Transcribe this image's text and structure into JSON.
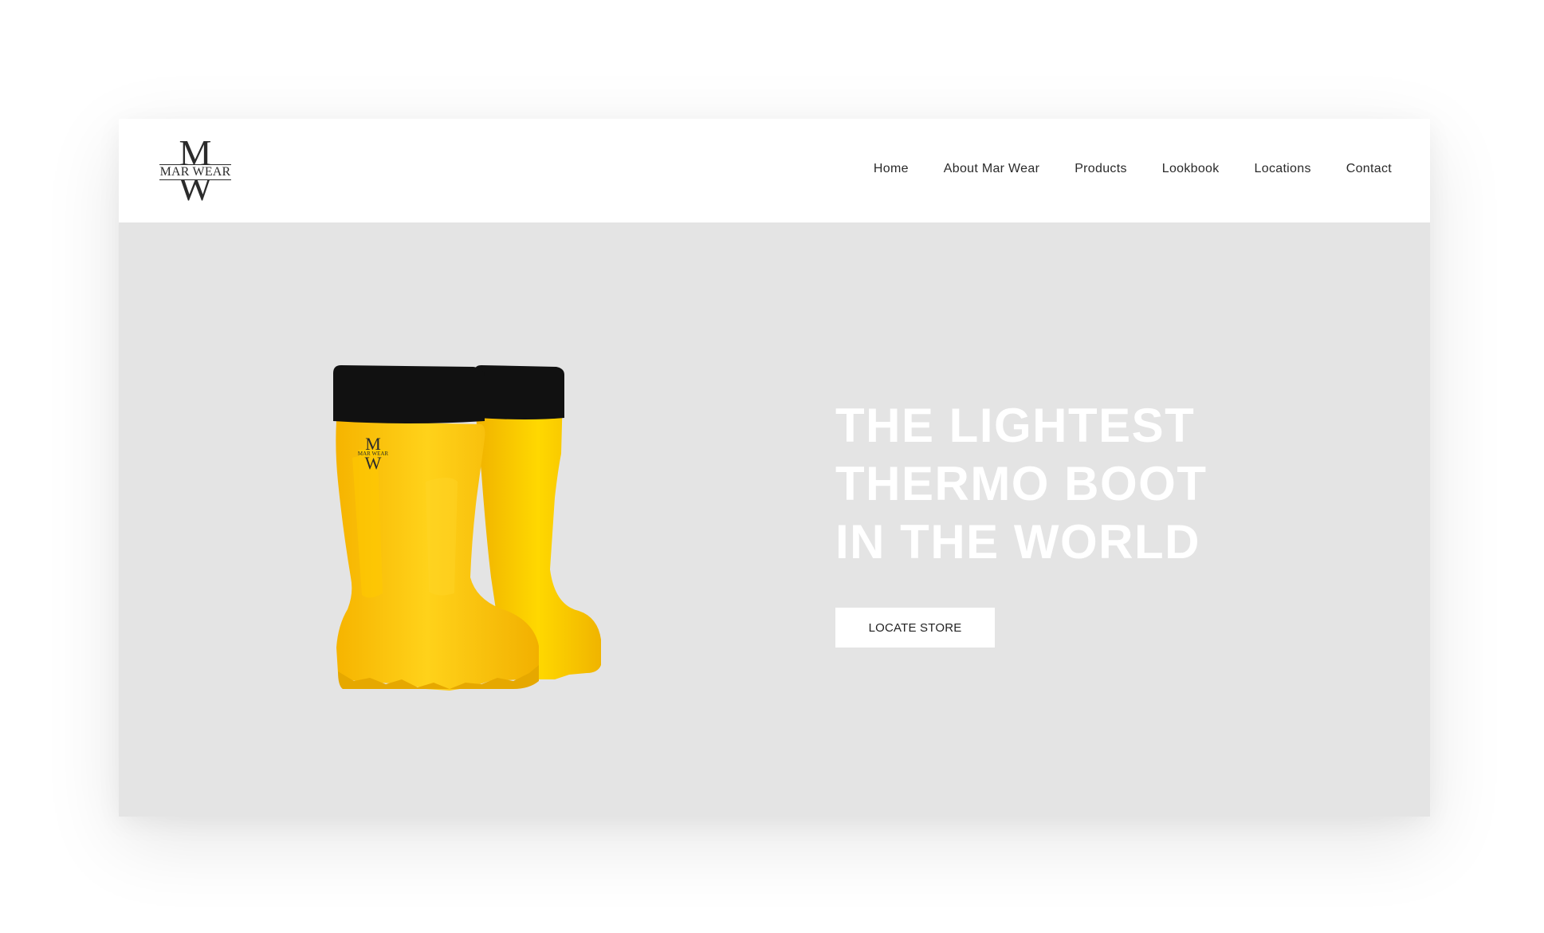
{
  "brand": {
    "logo_top": "M",
    "logo_text": "MAR WEAR",
    "logo_bottom": "W",
    "boot_logo_text": "MAR WEAR"
  },
  "nav": {
    "items": [
      {
        "label": "Home"
      },
      {
        "label": "About Mar Wear"
      },
      {
        "label": "Products"
      },
      {
        "label": "Lookbook"
      },
      {
        "label": "Locations"
      },
      {
        "label": "Contact"
      }
    ]
  },
  "hero": {
    "headline_lines": [
      "THE LIGHTEST",
      "THERMO BOOT",
      "IN THE WORLD"
    ],
    "cta_label": "LOCATE STORE",
    "background_color": "#e4e4e4",
    "boot_color": "#ffc800",
    "boot_cuff_color": "#111111"
  }
}
